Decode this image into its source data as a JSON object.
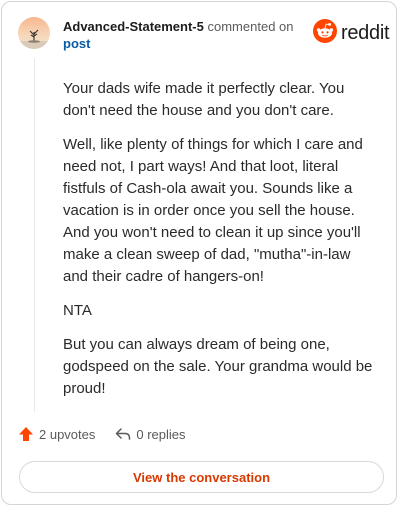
{
  "comment": {
    "username": "Advanced-Statement-5",
    "action_text": "commented on",
    "post_link": "post",
    "paragraphs": [
      "Your dads wife made it perfectly clear. You don't need the house and you don't care.",
      "Well, like plenty of things for which I care and need not, I part ways! And that loot, literal fistfuls of Cash-ola await you. Sounds like a vacation is in order once you sell the house. And you won't need to clean it up since you'll make a clean sweep of dad, \"mutha\"-in-law and their cadre of hangers-on!",
      "NTA",
      "But you can always dream of being one, godspeed on the sale. Your grandma would be proud!"
    ]
  },
  "brand": {
    "name": "reddit",
    "color": "#ff4500"
  },
  "stats": {
    "upvotes": "2 upvotes",
    "replies": "0 replies"
  },
  "cta": {
    "label": "View the conversation"
  },
  "icons": {
    "brand": "reddit-alien-icon",
    "upvote": "upvote-arrow-icon",
    "reply": "reply-arrow-icon"
  }
}
